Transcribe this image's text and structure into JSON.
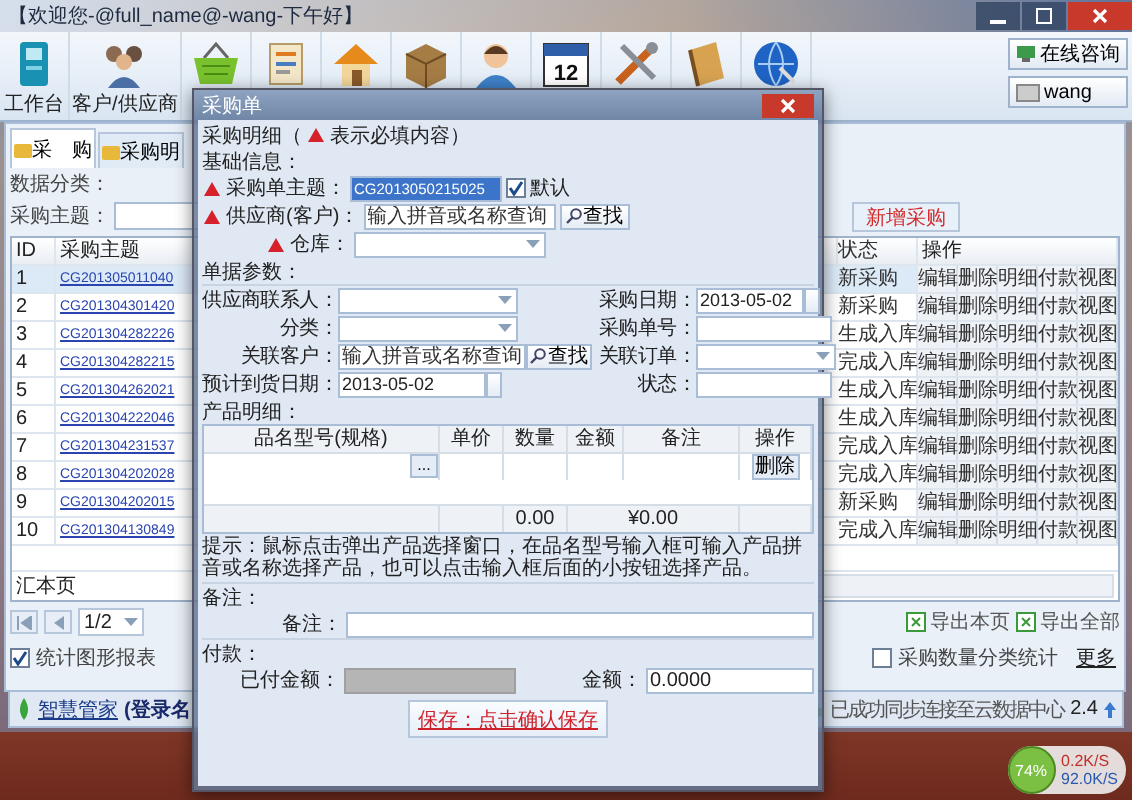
{
  "main_window": {
    "title": "【欢迎您-@full_name@-wang-下午好】",
    "toolbar": [
      {
        "kind": "workbench",
        "label": "工作台"
      },
      {
        "kind": "contacts",
        "label": "客户/供应商"
      },
      {
        "kind": "basket"
      },
      {
        "kind": "document"
      },
      {
        "kind": "house"
      },
      {
        "kind": "box"
      },
      {
        "kind": "person"
      },
      {
        "kind": "calendar",
        "icon_text": "12"
      },
      {
        "kind": "tools"
      },
      {
        "kind": "notebook"
      },
      {
        "kind": "globe"
      }
    ],
    "side_buttons": [
      {
        "kind": "chat",
        "label": "在线咨询"
      },
      {
        "kind": "user",
        "label": "wang"
      }
    ],
    "tabs": [
      {
        "label": "采　购",
        "selected": true
      },
      {
        "label": "采购明",
        "selected": false
      }
    ],
    "filter_label": "数据分类：",
    "subject_label": "采购主题：",
    "new_button": "新增采购",
    "table": {
      "columns": [
        "ID",
        "采购主题",
        "状态",
        "操作"
      ],
      "rows": [
        {
          "id": "1",
          "subject": "CG201305011040",
          "status": "新采购",
          "selected": true,
          "actions": [
            "编辑",
            "删除",
            "明细",
            "付款",
            "视图"
          ]
        },
        {
          "id": "2",
          "subject": "CG201304301420",
          "status": "新采购",
          "selected": false,
          "actions": [
            "编辑",
            "删除",
            "明细",
            "付款",
            "视图"
          ]
        },
        {
          "id": "3",
          "subject": "CG201304282226",
          "status": "生成入库",
          "selected": false,
          "actions": [
            "编辑",
            "删除",
            "明细",
            "付款",
            "视图"
          ]
        },
        {
          "id": "4",
          "subject": "CG201304282215",
          "status": "完成入库",
          "selected": false,
          "actions": [
            "编辑",
            "删除",
            "明细",
            "付款",
            "视图"
          ]
        },
        {
          "id": "5",
          "subject": "CG201304262021",
          "status": "生成入库",
          "selected": false,
          "actions": [
            "编辑",
            "删除",
            "明细",
            "付款",
            "视图"
          ]
        },
        {
          "id": "6",
          "subject": "CG201304222046",
          "status": "生成入库",
          "selected": false,
          "actions": [
            "编辑",
            "删除",
            "明细",
            "付款",
            "视图"
          ]
        },
        {
          "id": "7",
          "subject": "CG201304231537",
          "status": "完成入库",
          "selected": false,
          "actions": [
            "编辑",
            "删除",
            "明细",
            "付款",
            "视图"
          ]
        },
        {
          "id": "8",
          "subject": "CG201304202028",
          "status": "完成入库",
          "selected": false,
          "actions": [
            "编辑",
            "删除",
            "明细",
            "付款",
            "视图"
          ]
        },
        {
          "id": "9",
          "subject": "CG201304202015",
          "status": "新采购",
          "selected": false,
          "actions": [
            "编辑",
            "删除",
            "明细",
            "付款",
            "视图"
          ]
        },
        {
          "id": "10",
          "subject": "CG201304130849",
          "status": "完成入库",
          "selected": false,
          "actions": [
            "编辑",
            "删除",
            "明细",
            "付款",
            "视图"
          ]
        }
      ],
      "footer": "汇本页"
    },
    "pager": "1/2",
    "exports": [
      "导出本页",
      "导出全部"
    ],
    "options": [
      {
        "label": "统计图形报表",
        "checked": true
      },
      {
        "label": "采购数量分类统计",
        "checked": false
      }
    ],
    "more_link": "更多",
    "status_bar": {
      "brand": "智慧管家",
      "login": "(登录名",
      "sync": "已成功同步连接至云数据中心",
      "version": "2.4"
    }
  },
  "dialog": {
    "title": "采购单",
    "heading_start": "采购明细（",
    "heading_end": "表示必填内容）",
    "basic_label": "基础信息：",
    "subject": {
      "label": "采购单主题：",
      "value": "CG2013050215025",
      "required": true
    },
    "default_option": {
      "label": "默认",
      "checked": true
    },
    "supplier": {
      "label": "供应商(客户)：",
      "placeholder": "输入拼音或名称查询",
      "button": "查找",
      "required": true
    },
    "warehouse": {
      "label": "仓库：",
      "required": true
    },
    "params_label": "单据参数：",
    "fields": [
      {
        "kind": "select",
        "label": "供应商联系人："
      },
      {
        "kind": "date",
        "label": "采购日期：",
        "value": "2013-05-02"
      },
      {
        "kind": "select",
        "label": "分类："
      },
      {
        "kind": "text",
        "label": "采购单号："
      },
      {
        "kind": "search",
        "label": "关联客户：",
        "placeholder": "输入拼音或名称查询",
        "button": "查找"
      },
      {
        "kind": "select",
        "label": "关联订单："
      },
      {
        "kind": "date",
        "label": "预计到货日期：",
        "value": "2013-05-02"
      },
      {
        "kind": "text",
        "label": "状态："
      }
    ],
    "products": {
      "label": "产品明细：",
      "columns": [
        "品名型号(规格)",
        "单价",
        "数量",
        "金额",
        "备注",
        "操作"
      ],
      "row_button": "...",
      "delete_button": "删除",
      "total_quantity": "0.00",
      "total_amount": "¥0.00"
    },
    "hint": "提示：鼠标点击弹出产品选择窗口，在品名型号输入框可输入产品拼音或名称选择产品，也可以点击输入框后面的小按钮选择产品。",
    "remarks_section": "备注：",
    "remarks_label": "备注：",
    "payment_section": "付款：",
    "paid_label": "已付金额：",
    "amount_label": "金额：",
    "amount_value": "0.0000",
    "save_button": "保存：点击确认保存"
  },
  "net_widget": {
    "percent": "74%",
    "upload": "0.2K/S",
    "download": "92.0K/S"
  }
}
